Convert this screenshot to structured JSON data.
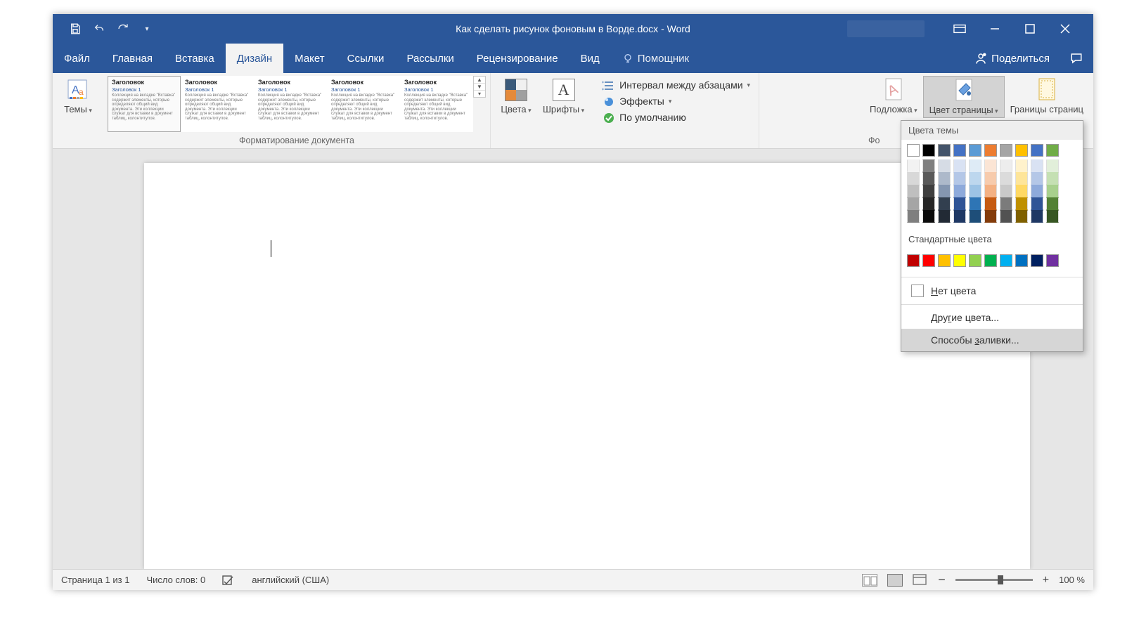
{
  "title_text": "Как сделать рисунок фоновым в Ворде.docx  -  Word",
  "qat": {
    "save": "save",
    "undo": "undo",
    "redo": "redo",
    "customize": "customize"
  },
  "window_controls": {
    "ribbon_opts": "ribbon-display",
    "minimize": "minimize",
    "maximize": "restore",
    "close": "close"
  },
  "tabs": {
    "file": "Файл",
    "home": "Главная",
    "insert": "Вставка",
    "design": "Дизайн",
    "layout": "Макет",
    "references": "Ссылки",
    "mailings": "Рассылки",
    "review": "Рецензирование",
    "view": "Вид",
    "active": "design"
  },
  "tellme": {
    "label": "Помощник"
  },
  "share": {
    "label": "Поделиться"
  },
  "ribbon": {
    "themes_btn": "Темы",
    "doc_formatting_label": "Форматирование документа",
    "gallery_items": [
      {
        "title": "Заголовок",
        "sub": "Заголовок 1",
        "selected": true
      },
      {
        "title": "Заголовок",
        "sub": "Заголовок 1",
        "selected": false
      },
      {
        "title": "Заголовок",
        "sub": "Заголовок 1",
        "selected": false
      },
      {
        "title": "Заголовок",
        "sub": "Заголовок 1",
        "selected": false
      },
      {
        "title": "Заголовок",
        "sub": "Заголовок 1",
        "selected": false
      }
    ],
    "colors_btn": "Цвета",
    "fonts_btn": "Шрифты",
    "paragraph_spacing": "Интервал между абзацами",
    "effects": "Эффекты",
    "set_default": "По умолчанию",
    "page_bg_group_partial": "Фо",
    "watermark": "Подложка",
    "page_color": "Цвет страницы",
    "page_borders": "Границы страниц"
  },
  "color_panel": {
    "theme_label": "Цвета темы",
    "theme_first_row": [
      "#ffffff",
      "#000000",
      "#44546a",
      "#4472c4",
      "#5b9bd5",
      "#ed7d31",
      "#a5a5a5",
      "#ffc000",
      "#4472c4",
      "#70ad47"
    ],
    "theme_tints": [
      [
        "#f2f2f2",
        "#7f7f7f",
        "#d6dce5",
        "#d9e2f3",
        "#deebf6",
        "#fbe5d5",
        "#ededed",
        "#fff2cc",
        "#d9e2f3",
        "#e2efda"
      ],
      [
        "#d8d8d8",
        "#595959",
        "#adb9ca",
        "#b4c7e7",
        "#bdd7ee",
        "#f7cbac",
        "#dbdbdb",
        "#fee599",
        "#b4c7e7",
        "#c5e0b3"
      ],
      [
        "#bfbfbf",
        "#3f3f3f",
        "#8496b0",
        "#8eaadb",
        "#9cc3e5",
        "#f4b183",
        "#c9c9c9",
        "#ffd965",
        "#8eaadb",
        "#a8d08d"
      ],
      [
        "#a5a5a5",
        "#262626",
        "#323f4f",
        "#2f5496",
        "#2e75b5",
        "#c55a11",
        "#7b7b7b",
        "#bf9000",
        "#2f5496",
        "#538135"
      ],
      [
        "#7f7f7f",
        "#0c0c0c",
        "#222a35",
        "#1f3864",
        "#1e4e79",
        "#833c0b",
        "#525252",
        "#7f6000",
        "#1f3864",
        "#375623"
      ]
    ],
    "standard_label": "Стандартные цвета",
    "standard_colors": [
      "#c00000",
      "#ff0000",
      "#ffc000",
      "#ffff00",
      "#92d050",
      "#00b050",
      "#00b0f0",
      "#0070c0",
      "#002060",
      "#7030a0"
    ],
    "no_color_pre": "Н",
    "no_color_post": "ет цвета",
    "more_colors_pre": "Дру",
    "more_colors_post": "гие цвета...",
    "fill_effects_pre": "Способы ",
    "fill_effects_key": "з",
    "fill_effects_post": "аливки..."
  },
  "status": {
    "page": "Страница 1 из 1",
    "words": "Число слов: 0",
    "language": "английский (США)",
    "zoom": "100 %"
  }
}
